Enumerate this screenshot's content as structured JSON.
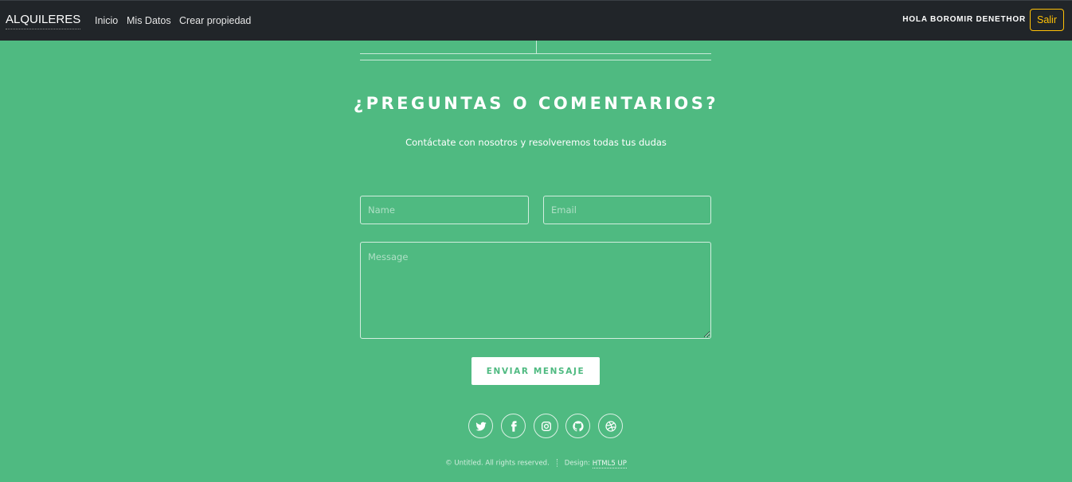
{
  "navbar": {
    "brand": "ALQUILERES",
    "links": [
      "Inicio",
      "Mis Datos",
      "Crear propiedad"
    ],
    "greeting": "HOLA BOROMIR DENETHOR",
    "logout_label": "Salir"
  },
  "contact": {
    "title": "¿PREGUNTAS O COMENTARIOS?",
    "subtitle": "Contáctate con nosotros y resolveremos todas tus dudas",
    "name_placeholder": "Name",
    "email_placeholder": "Email",
    "message_placeholder": "Message",
    "send_label": "ENVIAR MENSAJE"
  },
  "social_icons": [
    "twitter-icon",
    "facebook-icon",
    "instagram-icon",
    "github-icon",
    "dribbble-icon"
  ],
  "footer": {
    "copyright": "© Untitled. All rights reserved.",
    "design_label": "Design:",
    "design_link": "HTML5 UP"
  },
  "colors": {
    "background": "#4fba81",
    "navbar": "#212529",
    "logout_accent": "#ffc107"
  }
}
